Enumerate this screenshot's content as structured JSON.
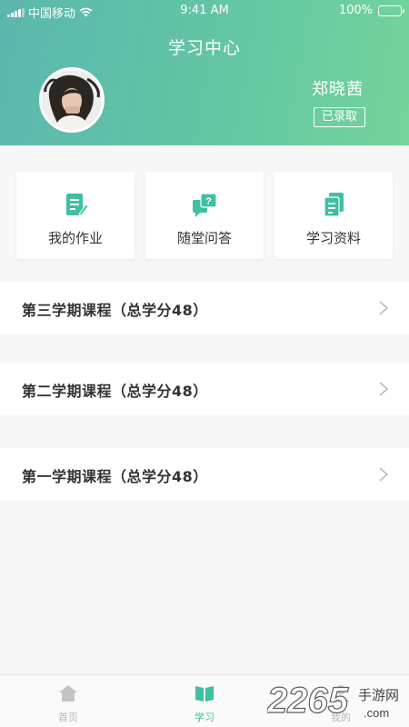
{
  "status_bar": {
    "carrier": "中国移动",
    "time": "9:41 AM",
    "battery": "100%"
  },
  "header": {
    "title": "学习中心",
    "user_name": "郑晓茜",
    "status_badge": "已录取"
  },
  "quick_actions": [
    {
      "label": "我的作业",
      "icon": "homework-icon"
    },
    {
      "label": "随堂问答",
      "icon": "qa-icon"
    },
    {
      "label": "学习资料",
      "icon": "materials-icon"
    }
  ],
  "courses": [
    {
      "title": "第三学期课程（总学分48）"
    },
    {
      "title": "第二学期课程（总学分48）"
    },
    {
      "title": "第一学期课程（总学分48）"
    }
  ],
  "tabbar": {
    "items": [
      {
        "label": "首页",
        "icon": "home-icon",
        "active": false
      },
      {
        "label": "学习",
        "icon": "book-icon",
        "active": true
      },
      {
        "label": "我的",
        "icon": "user-icon",
        "active": false
      }
    ]
  },
  "watermark": {
    "number": "2265",
    "cn": "手游网",
    "en": ".com"
  },
  "colors": {
    "accent": "#3fbfa3",
    "header_start": "#5bb7ae",
    "header_end": "#74d49a",
    "background": "#f7f7f7"
  }
}
